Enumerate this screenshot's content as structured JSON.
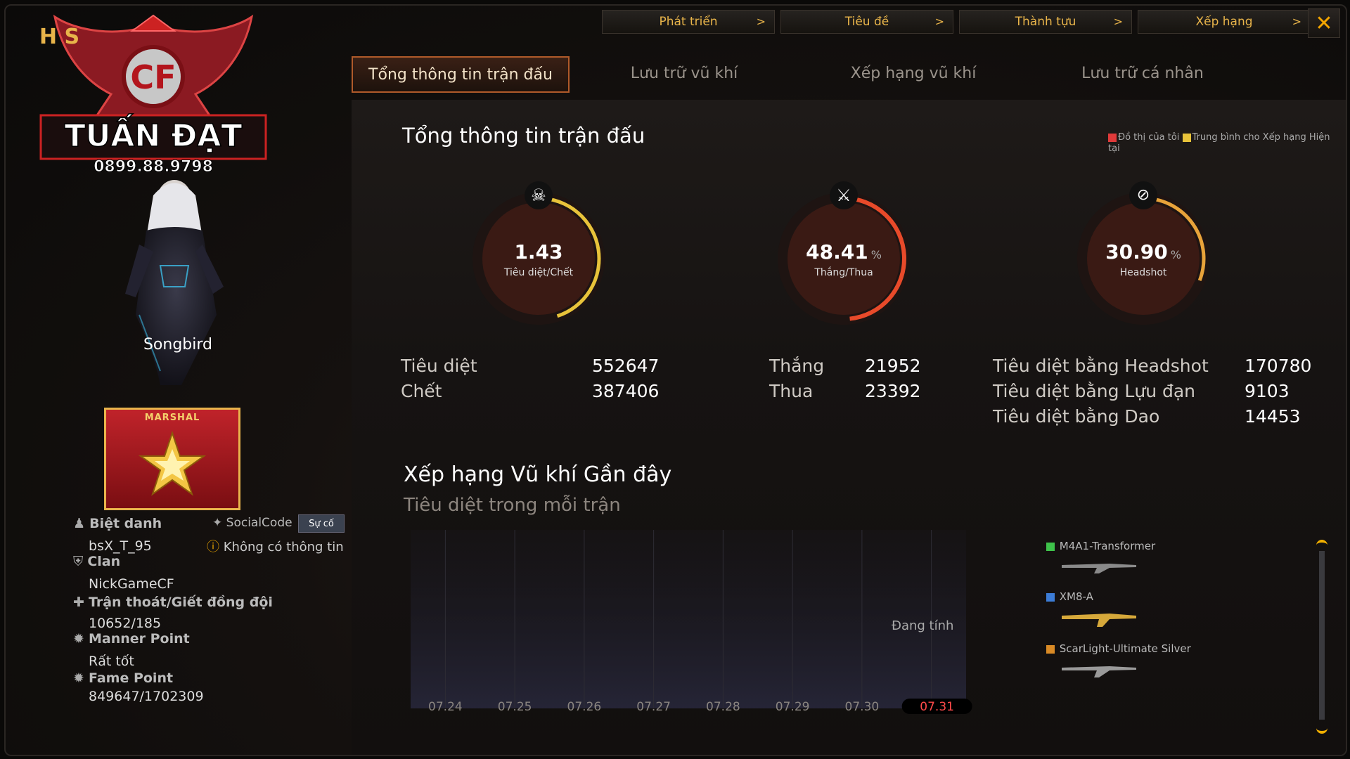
{
  "top_menu": [
    {
      "label": "Phát triển"
    },
    {
      "label": "Tiêu đề"
    },
    {
      "label": "Thành tựu"
    },
    {
      "label": "Xếp hạng"
    }
  ],
  "close_label": "✕",
  "tabs": [
    {
      "label": "Tổng thông tin trận đấu",
      "active": true
    },
    {
      "label": "Lưu trữ vũ khí"
    },
    {
      "label": "Xếp hạng vũ khí"
    },
    {
      "label": "Lưu trữ cá nhân"
    }
  ],
  "logo": {
    "brand": "TUẤN ĐẠT",
    "phone": "0899.88.9798",
    "partial": "H S"
  },
  "character": {
    "name": "Songbird"
  },
  "rank": {
    "label": "MARSHAL"
  },
  "profile": {
    "nickname_label": "Biệt danh",
    "nickname": "bsX_T_95",
    "socialcode_label": "SocialCode",
    "socialcode_btn": "Sự cố",
    "social_info": "Không có thông tin",
    "clan_label": "Clan",
    "clan": "NickGameCF",
    "escape_label": "Trận thoát/Giết đồng đội",
    "escape": "10652/185",
    "manner_label": "Manner Point",
    "manner": "Rất tốt",
    "fame_label": "Fame Point",
    "fame": "849647/1702309"
  },
  "summary": {
    "title": "Tổng thông tin trận đấu",
    "legend_mine": "Đồ thị của tôi",
    "legend_avg": "Trung bình cho Xếp hạng Hiện tại",
    "gauges": [
      {
        "value": "1.43",
        "unit": "",
        "label": "Tiêu diệt/Chết",
        "fraction": 0.45,
        "icon": "skull-icon"
      },
      {
        "value": "48.41",
        "unit": "%",
        "label": "Thắng/Thua",
        "fraction": 0.4841,
        "icon": "crossed-swords-icon"
      },
      {
        "value": "30.90",
        "unit": "%",
        "label": "Headshot",
        "fraction": 0.309,
        "icon": "headshot-icon"
      }
    ],
    "kills_label": "Tiêu diệt",
    "kills": "552647",
    "deaths_label": "Chết",
    "deaths": "387406",
    "wins_label": "Thắng",
    "wins": "21952",
    "losses_label": "Thua",
    "losses": "23392",
    "hs_label": "Tiêu diệt bằng Headshot",
    "hs": "170780",
    "grenade_label": "Tiêu diệt bằng Lựu đạn",
    "grenade": "9103",
    "knife_label": "Tiêu diệt bằng Dao",
    "knife": "14453"
  },
  "weapon_rank": {
    "title": "Xếp hạng Vũ khí Gần đây",
    "subtitle": "Tiêu diệt trong mỗi trận",
    "calculating": "Đang tính",
    "weapons": [
      {
        "name": "M4A1-Transformer",
        "color": "#3ec24a"
      },
      {
        "name": "XM8-A",
        "color": "#3c7cd6"
      },
      {
        "name": "ScarLight-Ultimate Silver",
        "color": "#d98a25"
      }
    ]
  },
  "chart_data": {
    "type": "line",
    "title": "Xếp hạng Vũ khí Gần đây",
    "subtitle": "Tiêu diệt trong mỗi trận",
    "categories": [
      "07.24",
      "07.25",
      "07.26",
      "07.27",
      "07.28",
      "07.29",
      "07.30",
      "07.31"
    ],
    "selected_category": "07.31",
    "series": [],
    "grid": true
  }
}
